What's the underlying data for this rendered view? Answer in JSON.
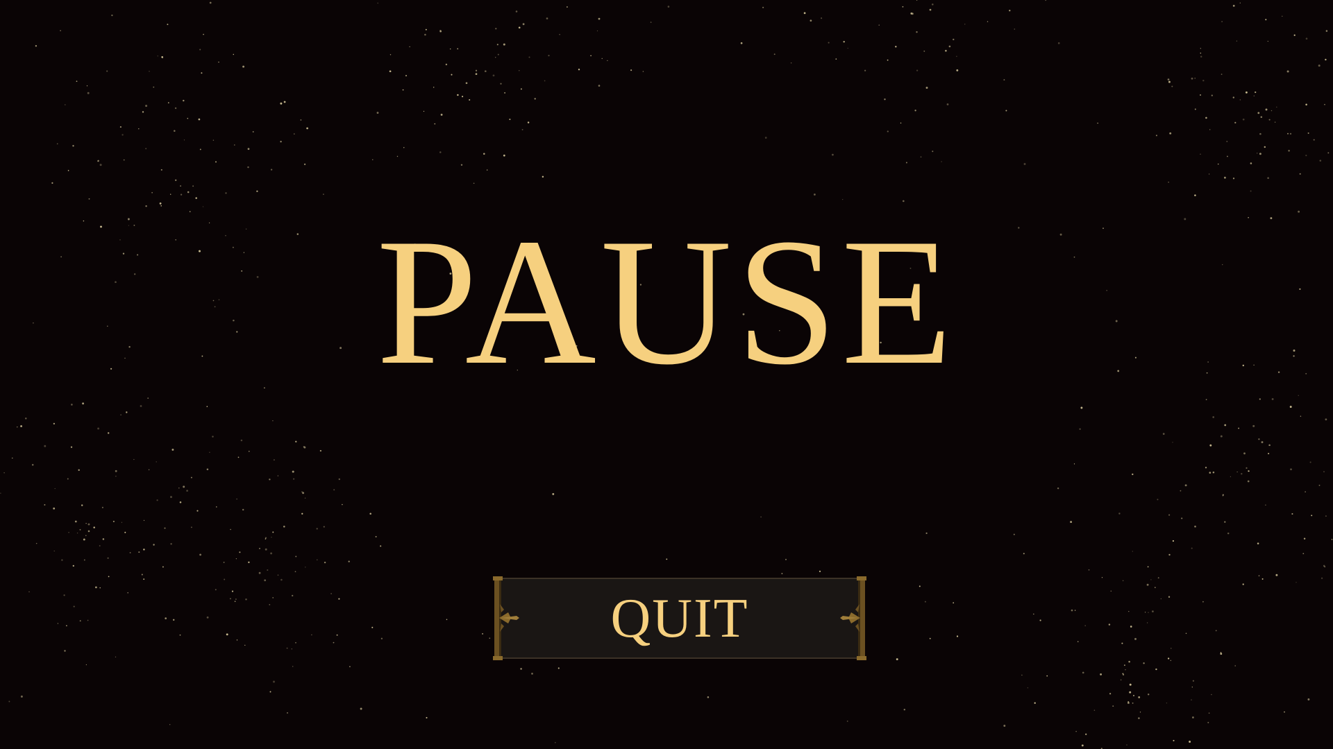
{
  "pause_menu": {
    "title": "PAUSE",
    "quit_label": "QUIT"
  },
  "colors": {
    "background": "#0a0405",
    "title_gold": "#f6d07f",
    "button_fill": "#1a1614",
    "ornament_gold": "#8a6a2c",
    "star": "#e8d9a8"
  }
}
